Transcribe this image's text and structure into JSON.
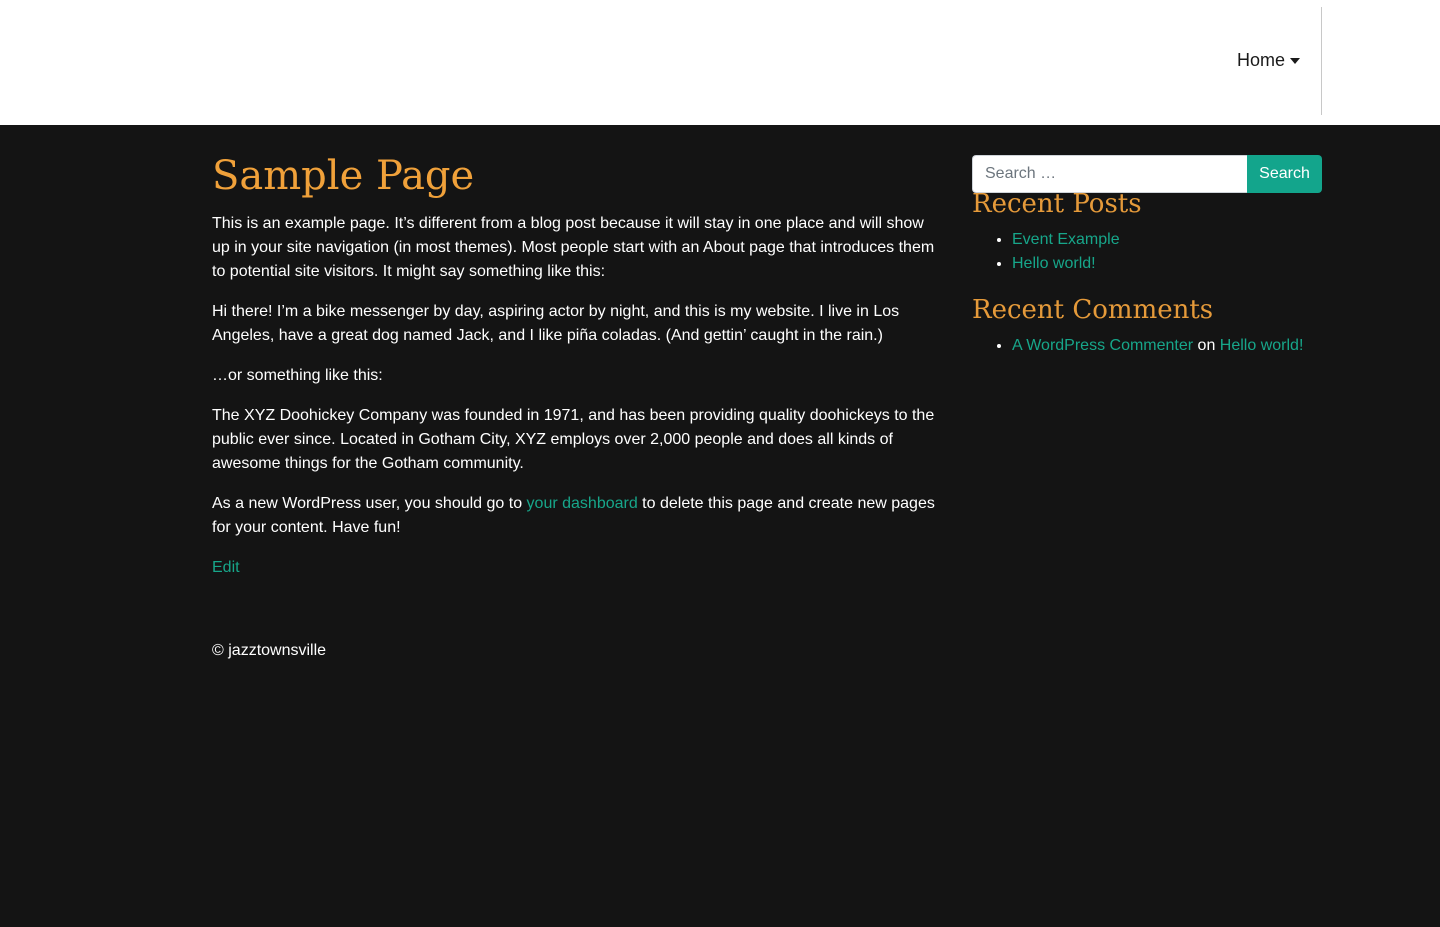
{
  "header": {
    "nav_home_label": "Home"
  },
  "main": {
    "title": "Sample Page",
    "paragraph_1": "This is an example page. It’s different from a blog post because it will stay in one place and will show up in your site navigation (in most themes). Most people start with an About page that introduces them to potential site visitors. It might say something like this:",
    "paragraph_2": "Hi there! I’m a bike messenger by day, aspiring actor by night, and this is my website. I live in Los Angeles, have a great dog named Jack, and I like piña coladas. (And gettin’ caught in the rain.)",
    "paragraph_3": "…or something like this:",
    "paragraph_4": "The XYZ Doohickey Company was founded in 1971, and has been providing quality doohickeys to the public ever since. Located in Gotham City, XYZ employs over 2,000 people and does all kinds of awesome things for the Gotham community.",
    "paragraph_5_before": "As a new WordPress user, you should go to ",
    "paragraph_5_link": "your dashboard",
    "paragraph_5_after": " to delete this page and create new pages for your content. Have fun!",
    "edit_label": "Edit"
  },
  "footer": {
    "copyright": "© jazztownsville"
  },
  "sidebar": {
    "search": {
      "placeholder": "Search …",
      "button_label": "Search"
    },
    "recent_posts": {
      "title": "Recent Posts",
      "items": [
        "Event Example",
        "Hello world!"
      ]
    },
    "recent_comments": {
      "title": "Recent Comments",
      "author": "A WordPress Commenter",
      "connector": "on",
      "post": "Hello world!"
    }
  },
  "colors": {
    "background": "#141414",
    "header_background": "#ffffff",
    "heading_accent": "#f0a13a",
    "link": "#17a68a",
    "button": "#13a58c"
  }
}
